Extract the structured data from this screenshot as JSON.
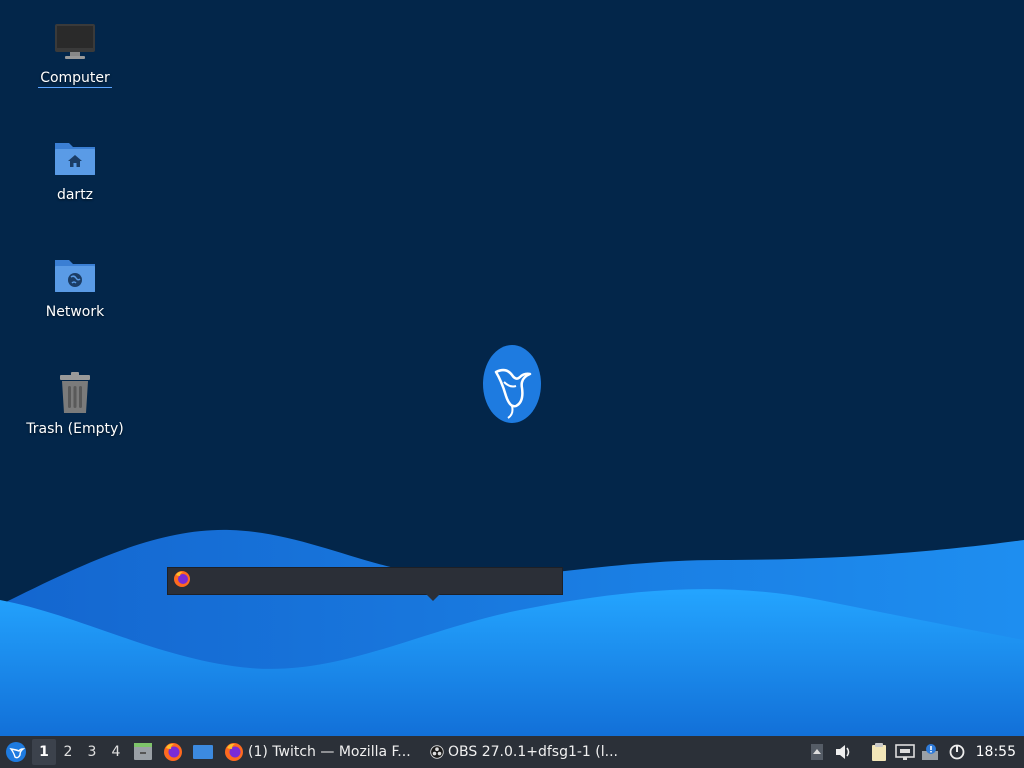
{
  "desktop": {
    "icons": [
      {
        "label": "Computer"
      },
      {
        "label": "dartz"
      },
      {
        "label": "Network"
      },
      {
        "label": "Trash (Empty)"
      }
    ]
  },
  "taskbar": {
    "workspaces": [
      "1",
      "2",
      "3",
      "4"
    ],
    "active_workspace": "1",
    "tasks": [
      {
        "title": "(1) Twitch — Mozilla F..."
      },
      {
        "title": "OBS 27.0.1+dfsg1-1 (l..."
      }
    ],
    "clock": "18:55"
  },
  "colors": {
    "background": "#03264a",
    "wave_light": "#1a93f0",
    "wave_dark": "#0f6fd6",
    "taskbar": "#2b3038",
    "accent": "#1e7be0"
  }
}
